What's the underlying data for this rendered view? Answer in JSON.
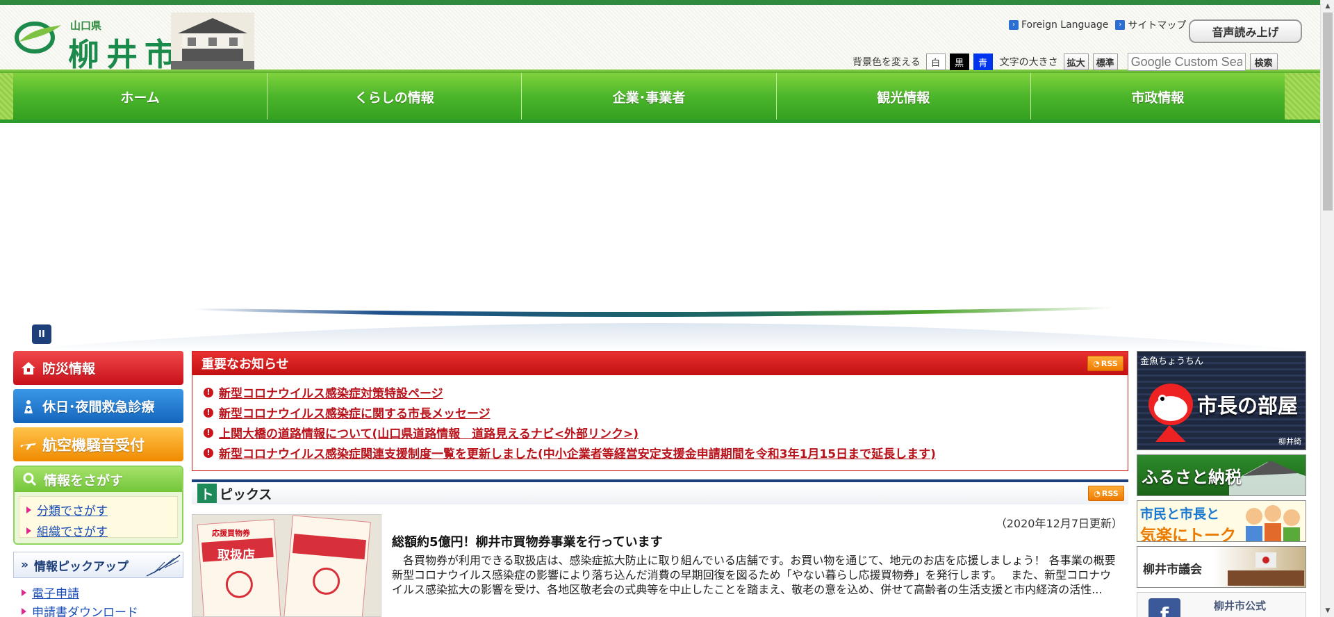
{
  "header": {
    "logo_pref": "山口県",
    "logo_city": "柳井市",
    "links": [
      {
        "label": "Foreign Language"
      },
      {
        "label": "サイトマップ"
      }
    ],
    "voice_button": "音声読み上げ",
    "bg_label": "背景色を変える",
    "bg_white": "白",
    "bg_black": "黒",
    "bg_blue": "青",
    "font_label": "文字の大きさ",
    "font_large": "拡大",
    "font_normal": "標準",
    "search_placeholder": "Google Custom Search",
    "search_button": "検索"
  },
  "gnav": [
    {
      "label": "ホーム"
    },
    {
      "label": "くらしの情報"
    },
    {
      "label": "企業･事業者"
    },
    {
      "label": "観光情報"
    },
    {
      "label": "市政情報"
    }
  ],
  "hero": {
    "pause_label": "II"
  },
  "left": {
    "bousai": "防災情報",
    "kyukyu": "休日･夜間救急診療",
    "koukuu": "航空機騒音受付",
    "search_title": "情報をさがす",
    "search_links": [
      {
        "label": "分類でさがす"
      },
      {
        "label": "組織でさがす"
      }
    ],
    "pickup_title": "情報ピックアップ",
    "pickup_links": [
      {
        "label": "電子申請"
      },
      {
        "label": "申請書ダウンロード"
      }
    ]
  },
  "notice": {
    "title": "重要なお知らせ",
    "rss": "RSS",
    "items": [
      {
        "label": "新型コロナウイルス感染症対策特設ページ"
      },
      {
        "label": "新型コロナウイルス感染症に関する市長メッセージ"
      },
      {
        "label": "上関大橋の道路情報について(山口県道路情報　道路見えるナビ<外部リンク>)"
      },
      {
        "label": "新型コロナウイルス感染症関連支援制度一覧を更新しました(中小企業者等経営安定支援金申請期間を令和3年1月15日まで延長します)"
      }
    ]
  },
  "topics": {
    "title_initial": "ト",
    "title_rest": "ピックス",
    "rss": "RSS",
    "date": "（2020年12月7日更新）",
    "headline": "総額約5億円！柳井市買物券事業を行っています",
    "body": "　各買物券が利用できる取扱店は、感染症拡大防止に取り組んでいる店舗です。お買い物を通じて、地元のお店を応援しましょう！ 各事業の概要　 新型コロナウイルス感染症の影響により落ち込んだ消費の早期回復を図るため「やない暮らし応援買物券」を発行します。　 また、新型コロナウイルス感染拡大の影響を受け、各地区敬老会の式典等を中止したことを踏まえ、敬老の意を込め、併せて高齢者の生活支援と市内経済の活性...",
    "image_text_1": "応援買物券",
    "image_text_2": "取扱店"
  },
  "right": {
    "mayor_small": "金魚ちょうちん",
    "mayor_big": "市長の部屋",
    "mayor_sign": "柳井綺",
    "furusato": "ふるさと納税",
    "talk_line1": "市民と市長と",
    "talk_line2": "気楽にトーク",
    "gikai": "柳井市議会",
    "fb": "柳井市公式"
  },
  "colors": {
    "accent_green": "#4bb52a",
    "alert_red": "#c21010",
    "navy": "#1d3f7a",
    "link_blue": "#1a4db8"
  }
}
